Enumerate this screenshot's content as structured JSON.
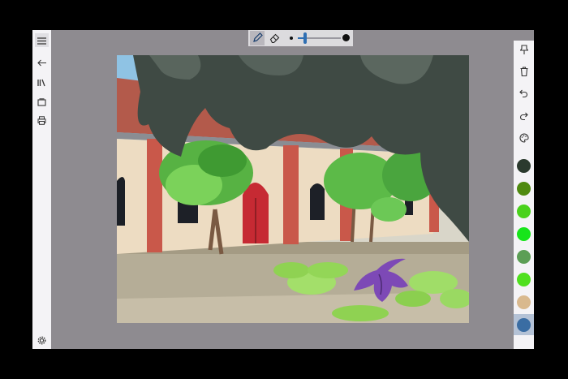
{
  "toolbar": {
    "active_tool": "pencil",
    "tools": [
      {
        "name": "pencil",
        "icon": "pencil-icon"
      },
      {
        "name": "eraser",
        "icon": "eraser-icon"
      }
    ],
    "brush_size": {
      "level": 0.15
    }
  },
  "leftbar": {
    "icons": [
      "hamburger-menu-icon",
      "back-arrow-icon",
      "library-icon",
      "gallery-icon",
      "print-icon",
      "settings-gear-icon"
    ]
  },
  "rightbar": {
    "icons": [
      "pin-icon",
      "trash-icon",
      "undo-icon",
      "redo-icon",
      "color-palette-icon"
    ],
    "swatches": [
      "#2b3a2e",
      "#4f8a10",
      "#4ad21c",
      "#17e51a",
      "#5c9e55",
      "#4fe01e",
      "#d9b98e",
      "#3a6da3"
    ],
    "selected_swatch": 7
  },
  "accent_color": "#2f6fb3"
}
